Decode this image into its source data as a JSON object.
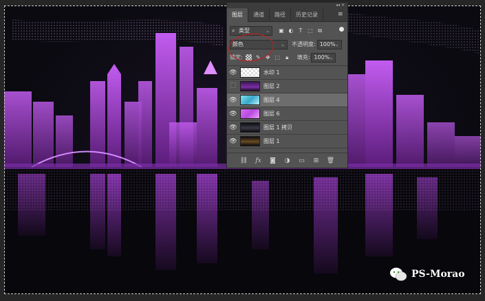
{
  "panel": {
    "tabs": [
      {
        "label": "图层",
        "active": true
      },
      {
        "label": "通道",
        "active": false
      },
      {
        "label": "路径",
        "active": false
      },
      {
        "label": "历史记录",
        "active": false
      }
    ],
    "filter": {
      "value": "类型"
    },
    "blend_mode": {
      "value": "颜色"
    },
    "opacity": {
      "label": "不透明度:",
      "value": "100%"
    },
    "lock": {
      "label": "锁定:"
    },
    "fill": {
      "label": "填充:",
      "value": "100%"
    },
    "layers": [
      {
        "name": "水印 1",
        "visible": true,
        "selected": false,
        "thumb": "checker"
      },
      {
        "name": "图层 2",
        "visible": false,
        "selected": false,
        "thumb": "dark-purple"
      },
      {
        "name": "图层 4",
        "visible": true,
        "selected": true,
        "thumb": "cyan"
      },
      {
        "name": "图层 6",
        "visible": true,
        "selected": false,
        "thumb": "magenta"
      },
      {
        "name": "图层 1 拷贝",
        "visible": true,
        "selected": false,
        "thumb": "night-city"
      },
      {
        "name": "图层 1",
        "visible": true,
        "selected": false,
        "thumb": "night-city-gold"
      }
    ]
  },
  "watermark": {
    "text": "PS-Morao"
  },
  "colors": {
    "accent_purple": "#b84be0",
    "annotation_red": "#d21a1a",
    "panel_bg": "#535353"
  },
  "icons": {
    "filter_icons": [
      "image-filter-icon",
      "adjustment-filter-icon",
      "type-filter-icon",
      "shape-filter-icon",
      "smart-object-filter-icon"
    ],
    "lock_icons": [
      "lock-transparent-icon",
      "lock-paint-icon",
      "lock-position-icon",
      "lock-artboard-icon",
      "lock-all-icon"
    ],
    "footer_icons": [
      "link-layers-icon",
      "fx-icon",
      "add-mask-icon",
      "adjustment-layer-icon",
      "new-group-icon",
      "new-layer-icon",
      "delete-layer-icon"
    ]
  }
}
